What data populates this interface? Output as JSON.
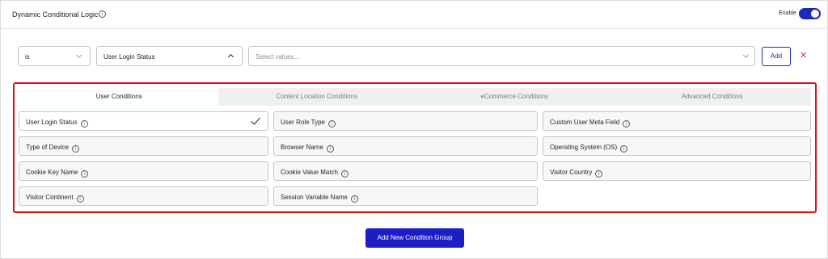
{
  "header": {
    "title": "Dynamic Conditional Logic",
    "enable_label": "Enable",
    "enabled": true
  },
  "rule": {
    "operator": "is",
    "condition": "User Login Status",
    "values_placeholder": "Select values...",
    "add_label": "Add",
    "remove_glyph": "✕"
  },
  "tabs": [
    {
      "label": "User Conditions",
      "active": true
    },
    {
      "label": "Content Location Conditions",
      "active": false
    },
    {
      "label": "eCommerce Conditions",
      "active": false
    },
    {
      "label": "Advanced Conditions",
      "active": false
    }
  ],
  "options": [
    {
      "label": "User Login Status",
      "selected": true
    },
    {
      "label": "User Role Type",
      "selected": false
    },
    {
      "label": "Custom User Meta Field",
      "selected": false
    },
    {
      "label": "Type of Device",
      "selected": false
    },
    {
      "label": "Browser Name",
      "selected": false
    },
    {
      "label": "Operating System (OS)",
      "selected": false
    },
    {
      "label": "Cookie Key Name",
      "selected": false
    },
    {
      "label": "Cookie Value Match",
      "selected": false
    },
    {
      "label": "Visitor Country",
      "selected": false
    },
    {
      "label": "Visitor Continent",
      "selected": false
    },
    {
      "label": "Session Variable Name",
      "selected": false
    }
  ],
  "footer": {
    "add_group_label": "Add New Condition Group"
  },
  "colors": {
    "accent": "#1d2bb8",
    "highlight_border": "#d9121a",
    "remove": "#d63638"
  },
  "icons": {
    "info": "info-icon",
    "check": "check-icon",
    "chevron_down": "chevron-down-icon",
    "chevron_up": "chevron-up-icon",
    "close": "close-icon"
  }
}
